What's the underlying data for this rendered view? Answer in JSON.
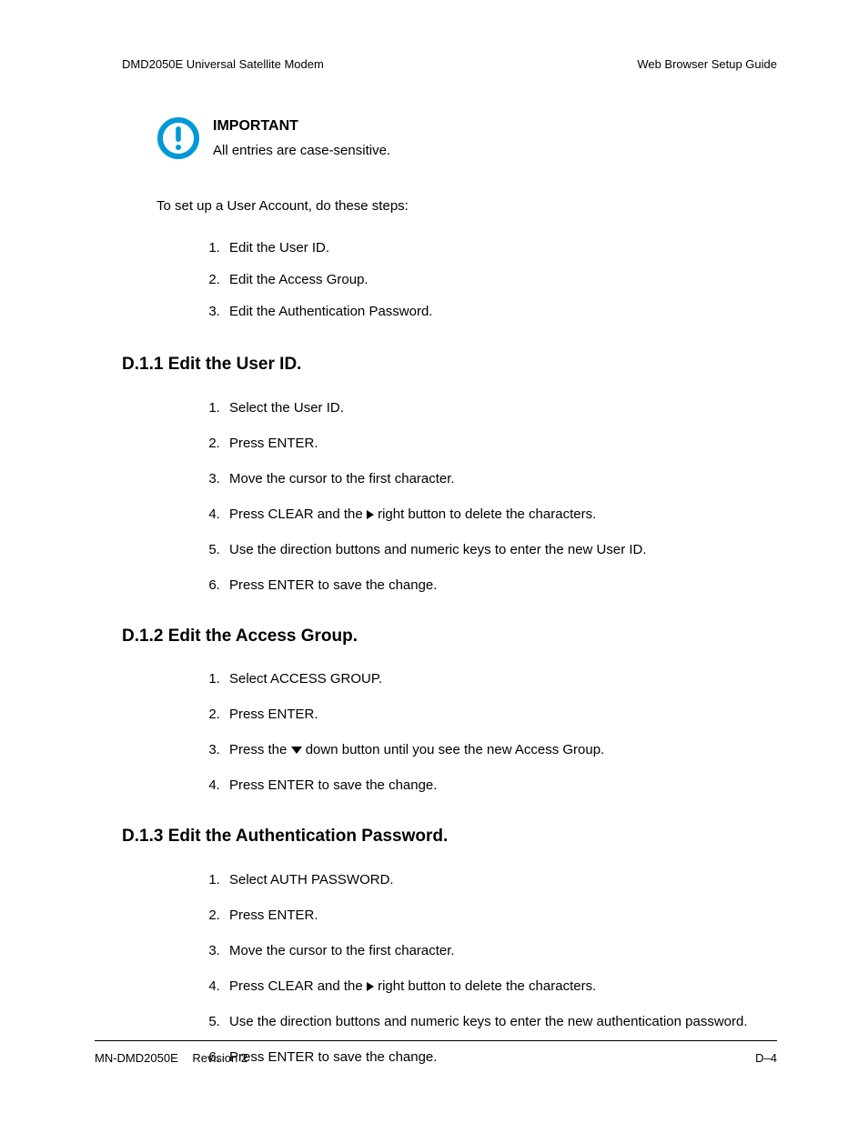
{
  "header": {
    "left": "DMD2050E Universal Satellite Modem",
    "right": "Web Browser Setup Guide"
  },
  "callout": {
    "title": "IMPORTANT",
    "body": "All entries are case-sensitive."
  },
  "intro": "To set up a User Account, do these steps:",
  "top_steps": [
    "Edit the User ID.",
    "Edit the Access Group.",
    "Edit the Authentication Password."
  ],
  "sections": [
    {
      "heading": "D.1.1 Edit the User ID.",
      "steps": [
        {
          "t": "Select the User ID."
        },
        {
          "t": "Press ENTER."
        },
        {
          "t": "Move the cursor to the first character."
        },
        {
          "pre": "Press CLEAR and the ",
          "icon": "right",
          "post": " right button to delete the characters."
        },
        {
          "t": "Use the direction buttons and numeric keys to enter the new User ID."
        },
        {
          "t": "Press ENTER to save the change."
        }
      ]
    },
    {
      "heading": "D.1.2 Edit the Access Group.",
      "steps": [
        {
          "t": "Select ACCESS GROUP."
        },
        {
          "t": "Press ENTER."
        },
        {
          "pre": "Press the ",
          "icon": "down",
          "post": " down button until you see the new Access Group."
        },
        {
          "t": "Press ENTER to save the change."
        }
      ]
    },
    {
      "heading": "D.1.3 Edit the Authentication Password.",
      "steps": [
        {
          "t": "Select AUTH PASSWORD."
        },
        {
          "t": "Press ENTER."
        },
        {
          "t": "Move the cursor to the first character."
        },
        {
          "pre": "Press CLEAR and the ",
          "icon": "right",
          "post": " right button to delete the characters."
        },
        {
          "t": "Use the direction buttons and numeric keys to enter the new authentication password."
        },
        {
          "t": "Press ENTER to save the change."
        }
      ]
    }
  ],
  "footer": {
    "doc": "MN-DMD2050E",
    "rev": "Revision 2",
    "page": "D–4"
  }
}
